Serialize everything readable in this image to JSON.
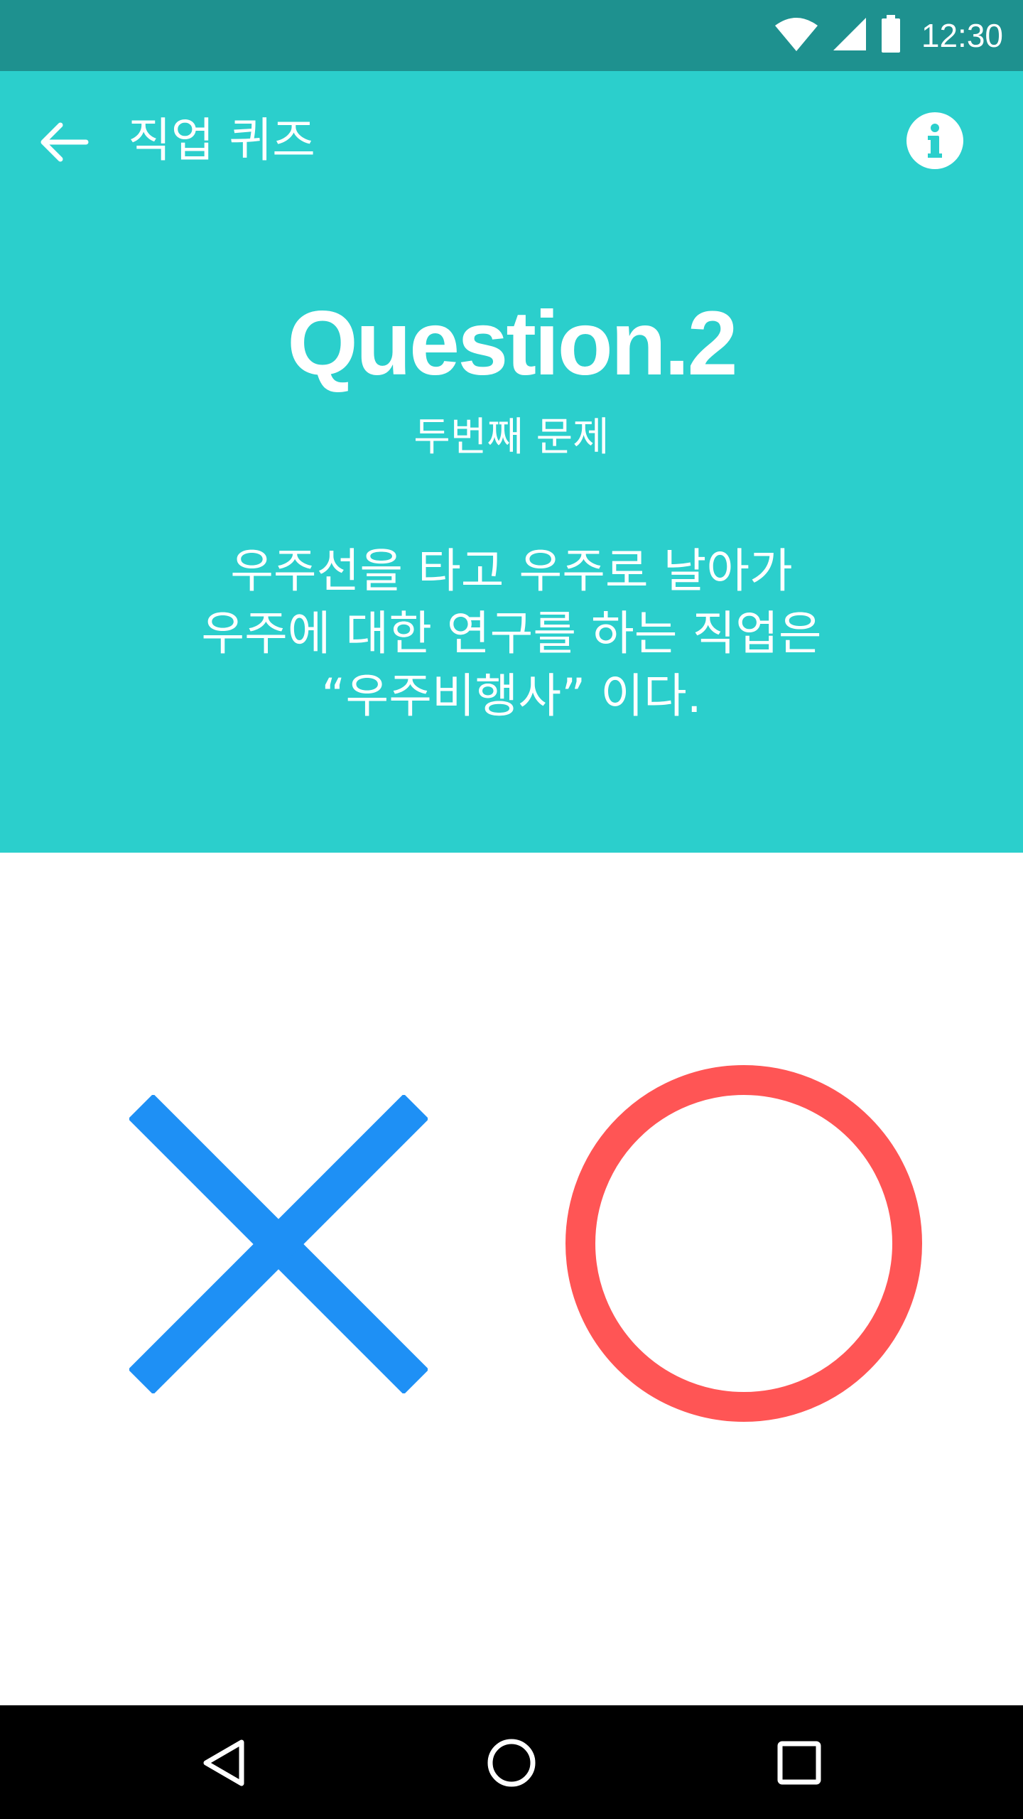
{
  "status_bar": {
    "time": "12:30",
    "icons": [
      "wifi-icon",
      "cell-signal-icon",
      "battery-icon"
    ]
  },
  "toolbar": {
    "title": "직업 퀴즈",
    "back_icon": "arrow-back-icon",
    "info_icon": "info-icon"
  },
  "question": {
    "title": "Question.2",
    "subtitle": "두번째 문제",
    "lines": [
      "우주선을 타고 우주로 날아가",
      "우주에 대한 연구를 하는 직업은",
      "“우주비행사” 이다."
    ]
  },
  "answers": {
    "false_icon": "x-mark-icon",
    "true_icon": "o-circle-icon"
  },
  "nav_bar": {
    "back": "nav-back-icon",
    "home": "nav-home-icon",
    "recents": "nav-recents-icon"
  },
  "colors": {
    "status_bar": "#1e918f",
    "header": "#2bcfcc",
    "x_mark": "#1e90f5",
    "o_circle": "#ff5555",
    "nav_bar": "#000000"
  }
}
